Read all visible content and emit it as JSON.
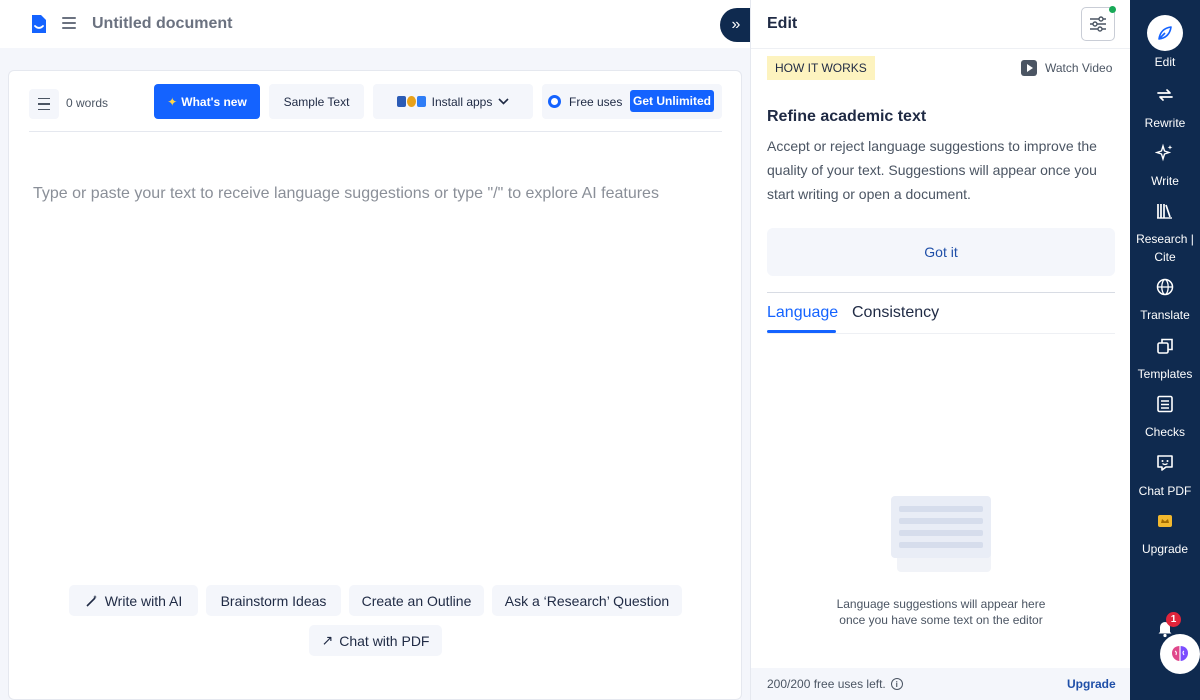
{
  "header": {
    "doc_title": "Untitled document"
  },
  "toolbar": {
    "word_count": "0 words",
    "whats_new": "What's new",
    "sample_text": "Sample Text",
    "install_apps": "Install apps",
    "free_uses": "Free uses",
    "get_unlimited": "Get Unlimited"
  },
  "editor": {
    "placeholder": "Type or paste your text to receive language suggestions or type \"/\" to explore AI features",
    "chips": [
      {
        "label": "Write with AI",
        "icon": "magic-wand-icon"
      },
      {
        "label": "Brainstorm Ideas"
      },
      {
        "label": "Create an Outline"
      },
      {
        "label": "Ask a ‘Research’ Question"
      },
      {
        "label": "Chat with PDF",
        "icon": "arrow-up-right-icon"
      }
    ]
  },
  "panel": {
    "title": "Edit",
    "how_it_works": "HOW IT WORKS",
    "watch_video": "Watch Video",
    "refine_title": "Refine academic text",
    "refine_body": "Accept or reject language suggestions to improve the quality of your text. Suggestions will appear once you start writing or open a document.",
    "got_it": "Got it",
    "tabs": [
      "Language",
      "Consistency"
    ],
    "empty_message_line1": "Language suggestions will appear here",
    "empty_message_line2": "once you have some text on the editor",
    "footer_free_left": "200/200 free uses left.",
    "footer_upgrade": "Upgrade"
  },
  "rail": {
    "items": [
      {
        "label": "Edit",
        "icon": "pen-nib-icon"
      },
      {
        "label": "Rewrite",
        "icon": "repeat-icon"
      },
      {
        "label": "Write",
        "icon": "sparkles-icon"
      },
      {
        "label": "Research |",
        "label2": "Cite",
        "icon": "books-icon"
      },
      {
        "label": "Translate",
        "icon": "globe-icon"
      },
      {
        "label": "Templates",
        "icon": "copy-icon"
      },
      {
        "label": "Checks",
        "icon": "checklist-icon"
      },
      {
        "label": "Chat PDF",
        "icon": "chat-icon"
      },
      {
        "label": "Upgrade",
        "icon": "crown-icon"
      }
    ],
    "notification_count": "1"
  },
  "colors": {
    "primary": "#1463ff",
    "navy": "#0f2a4f",
    "highlight": "#fdf3bf",
    "soft_bg": "#f4f6fb"
  }
}
